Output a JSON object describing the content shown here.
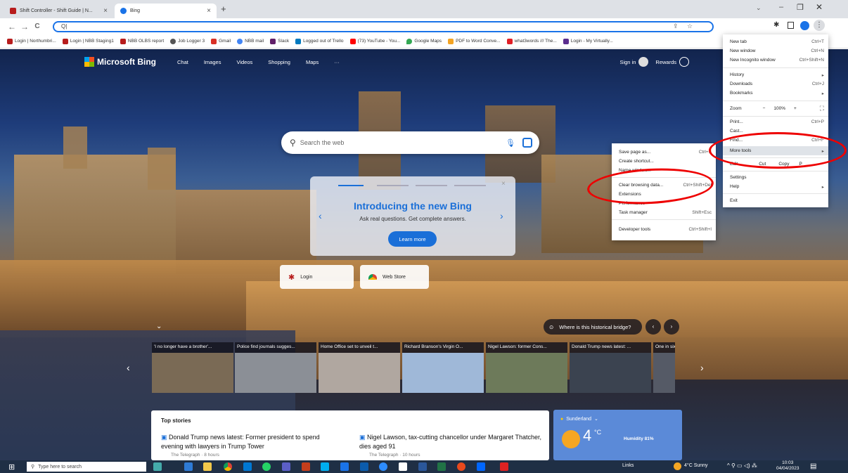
{
  "tabs": [
    {
      "title": "Shift Controller - Shift Guide | N..."
    },
    {
      "title": "Bing"
    }
  ],
  "new_tab_symbol": "+",
  "toolbar": {
    "back": "←",
    "forward": "→",
    "reload": "C",
    "address_value": "Q|"
  },
  "bookmarks": [
    {
      "label": "Login | Northumbri...",
      "color": "#b71c1c"
    },
    {
      "label": "Login | NBB Staging1",
      "color": "#b71c1c"
    },
    {
      "label": "NBB OLBS report",
      "color": "#b71c1c"
    },
    {
      "label": "Job Logger 3",
      "color": "#555555"
    },
    {
      "label": "Gmail",
      "color": "#d93025"
    },
    {
      "label": "NBB mail",
      "color": "#4285f4"
    },
    {
      "label": "Slack",
      "color": "#611f69"
    },
    {
      "label": "Logged out of Trello",
      "color": "#0079bf"
    },
    {
      "label": "(73) YouTube - You...",
      "color": "#ff0000"
    },
    {
      "label": "Google Maps",
      "color": "#34a853"
    },
    {
      "label": "PDF to Word Conve...",
      "color": "#f4a423"
    },
    {
      "label": "what3words /// The...",
      "color": "#e11f26"
    },
    {
      "label": "Login - My Virtually...",
      "color": "#5b2d8e"
    }
  ],
  "bing": {
    "logo": "Microsoft Bing",
    "nav": [
      "Chat",
      "Images",
      "Videos",
      "Shopping",
      "Maps",
      "···"
    ],
    "signin": "Sign in",
    "rewards": "Rewards",
    "search_placeholder": "Search the web"
  },
  "promo": {
    "title": "Introducing the new Bing",
    "subtitle": "Ask real questions. Get complete answers.",
    "button": "Learn more"
  },
  "tiles": [
    {
      "label": "Login"
    },
    {
      "label": "Web Store"
    }
  ],
  "image_question": "Where is this historical bridge?",
  "news": [
    {
      "caption": "'I no longer have a brother'...",
      "color": "#7a6a55"
    },
    {
      "caption": "Police find journals sugges...",
      "color": "#8b8f96"
    },
    {
      "caption": "Home Office set to unveil t...",
      "color": "#b0a7a0"
    },
    {
      "caption": "Richard Branson's Virgin O...",
      "color": "#9fb8d8"
    },
    {
      "caption": "Nigel Lawson: former Cons...",
      "color": "#6d7a5a"
    },
    {
      "caption": "Donald Trump news latest: ...",
      "color": "#3b4350"
    },
    {
      "caption": "One in six p",
      "color": "#555a66"
    }
  ],
  "top_stories": {
    "heading": "Top stories",
    "items": [
      {
        "title": "Donald Trump news latest: Former president to spend evening with lawyers in Trump Tower",
        "source": "The Telegraph · 8 hours"
      },
      {
        "title": "Nigel Lawson, tax-cutting chancellor under Margaret Thatcher, dies aged 91",
        "source": "The Telegraph · 10 hours"
      }
    ]
  },
  "weather": {
    "location": "Sunderland",
    "temp": "4",
    "unit": "°C",
    "humidity": "Humidity 81%"
  },
  "chrome_menu": {
    "items": [
      {
        "label": "New tab",
        "shortcut": "Ctrl+T"
      },
      {
        "label": "New window",
        "shortcut": "Ctrl+N"
      },
      {
        "label": "New Incognito window",
        "shortcut": "Ctrl+Shift+N"
      },
      {
        "label": "History",
        "shortcut": "▸"
      },
      {
        "label": "Downloads",
        "shortcut": "Ctrl+J"
      },
      {
        "label": "Bookmarks",
        "shortcut": "▸"
      },
      {
        "label": "Zoom",
        "shortcut": ""
      },
      {
        "label": "Print...",
        "shortcut": "Ctrl+P"
      },
      {
        "label": "Cast...",
        "shortcut": ""
      },
      {
        "label": "Find...",
        "shortcut": "Ctrl+F"
      },
      {
        "label": "More tools",
        "shortcut": "▸"
      },
      {
        "label": "Edit",
        "shortcut": ""
      },
      {
        "label": "Settings",
        "shortcut": ""
      },
      {
        "label": "Help",
        "shortcut": "▸"
      },
      {
        "label": "Exit",
        "shortcut": ""
      }
    ],
    "zoom_minus": "−",
    "zoom_level": "100%",
    "zoom_plus": "+",
    "fullscreen": "⛶",
    "edit_cut": "Cut",
    "edit_copy": "Copy",
    "edit_paste": "P"
  },
  "more_tools": [
    {
      "label": "Save page as...",
      "shortcut": "Ctrl+S"
    },
    {
      "label": "Create shortcut...",
      "shortcut": ""
    },
    {
      "label": "Name window...",
      "shortcut": ""
    },
    {
      "label": "Clear browsing data...",
      "shortcut": "Ctrl+Shift+Del"
    },
    {
      "label": "Extensions",
      "shortcut": ""
    },
    {
      "label": "Performance",
      "shortcut": ""
    },
    {
      "label": "Task manager",
      "shortcut": "Shift+Esc"
    },
    {
      "label": "Developer tools",
      "shortcut": "Ctrl+Shift+I"
    }
  ],
  "taskbar": {
    "search_placeholder": "Type here to search",
    "links": "Links",
    "weather": "4°C Sunny",
    "time": "10:03",
    "date": "04/04/2023"
  }
}
